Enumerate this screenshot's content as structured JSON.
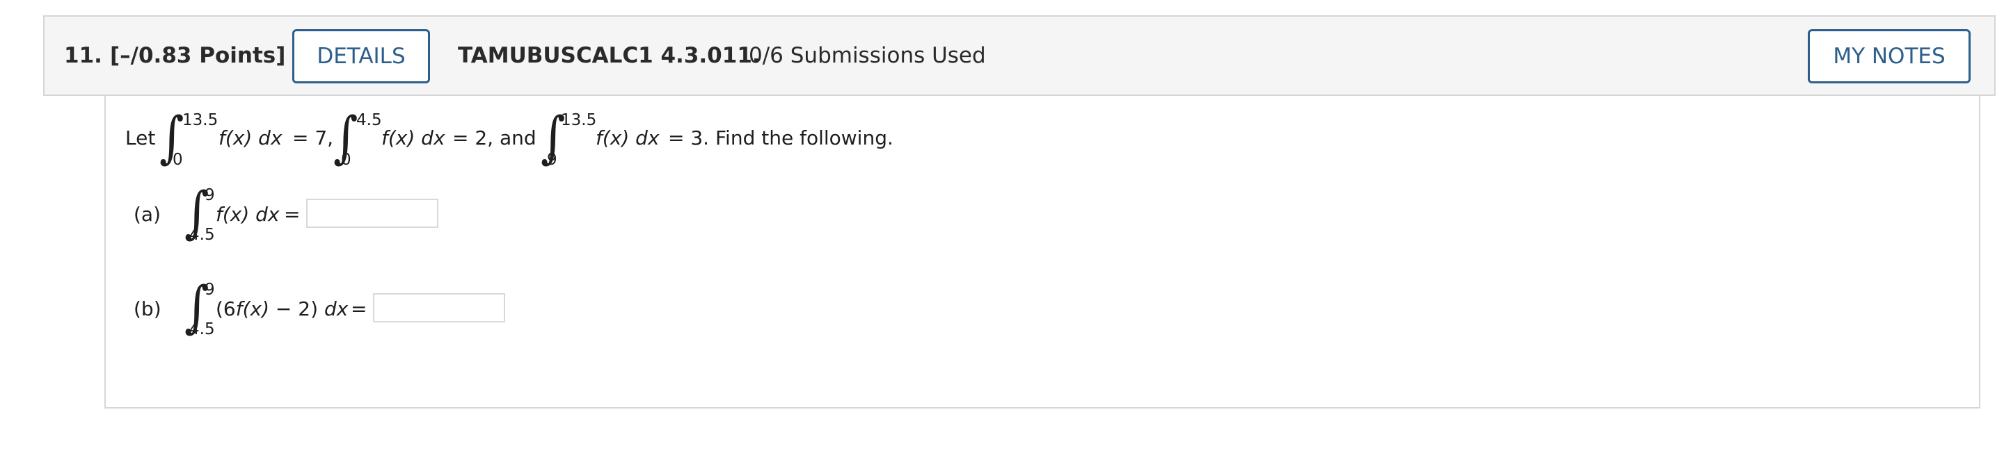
{
  "header": {
    "number": "11.",
    "points": "[–/0.83 Points]",
    "details_label": "DETAILS",
    "code": "TAMUBUSCALC1 4.3.011.",
    "submissions": "0/6 Submissions Used",
    "notes_label": "MY NOTES"
  },
  "colors": {
    "accent": "#2d5f8b",
    "header_bg": "#f5f5f5",
    "border": "#d6d6d6"
  },
  "problem": {
    "let": "Let",
    "integral_symbol": "∫",
    "i1": {
      "upper": "13.5",
      "lower": "0",
      "fx": "f(x) dx",
      "rest": "= 7,"
    },
    "i2": {
      "upper": "4.5",
      "lower": "0",
      "fx": "f(x) dx",
      "rest": "= 2, and"
    },
    "i3": {
      "upper": "13.5",
      "lower": "9",
      "fx": "f(x) dx",
      "rest": "= 3. Find the following."
    },
    "a": {
      "label": "(a)",
      "upper": "9",
      "lower": "4.5",
      "expr": "f(x) dx",
      "eq": "=",
      "value": ""
    },
    "b": {
      "label": "(b)",
      "upper": "9",
      "lower": "4.5",
      "expr_open": "(6",
      "expr_f": "f(x)",
      "expr_mid": " − 2) ",
      "expr_dx": "dx",
      "eq": "=",
      "value": ""
    }
  }
}
